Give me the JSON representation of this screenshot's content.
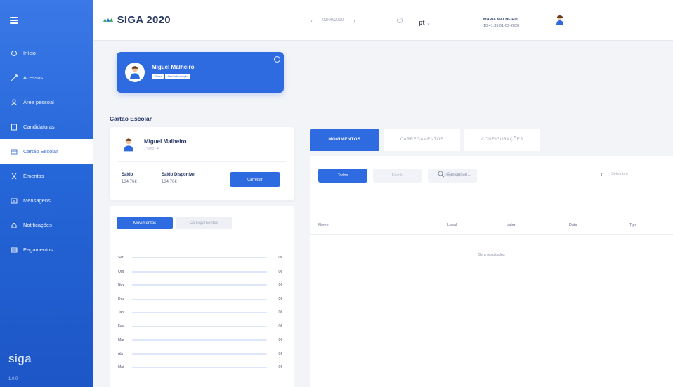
{
  "app": {
    "title": "SIGA 2020",
    "logo_text": "siga",
    "version": "1.0.0"
  },
  "colors": {
    "primary": "#2f6be0",
    "sidebar": "#2566d8",
    "background": "#f3f4f8"
  },
  "sidebar": {
    "items": [
      {
        "label": "Início",
        "icon": "home-icon",
        "active": false
      },
      {
        "label": "Acessos",
        "icon": "key-icon",
        "active": false
      },
      {
        "label": "Área pessoal",
        "icon": "user-icon",
        "active": false
      },
      {
        "label": "Candidaturas",
        "icon": "document-icon",
        "active": false
      },
      {
        "label": "Cartão Escolar",
        "icon": "card-icon",
        "active": true
      },
      {
        "label": "Ementas",
        "icon": "cutlery-icon",
        "active": false
      },
      {
        "label": "Mensagens",
        "icon": "message-icon",
        "active": false
      },
      {
        "label": "Notificações",
        "icon": "bell-icon",
        "active": false
      },
      {
        "label": "Pagamentos",
        "icon": "payment-icon",
        "active": false
      }
    ]
  },
  "header": {
    "date": "01/09/2020",
    "language": "pt",
    "user_name": "MARIA MALHEIRO",
    "user_datetime": "10:41:35 01-09-2020"
  },
  "profile": {
    "name": "Miguel Malheiro",
    "tags": [
      "1º ano",
      "Sem informação"
    ]
  },
  "section_title": "Cartão Escolar",
  "balance_card": {
    "name": "Miguel Malheiro",
    "subtitle": "1º ano · A",
    "saldo_label": "Saldo",
    "saldo_value": "134,76€",
    "disponivel_label": "Saldo Disponível",
    "disponivel_value": "134,76€",
    "load_button": "Carregar"
  },
  "chart_card": {
    "tabs": [
      {
        "label": "Movimentos",
        "active": true
      },
      {
        "label": "Carregamentos",
        "active": false
      }
    ]
  },
  "chart_data": {
    "type": "bar",
    "categories": [
      "Set",
      "Out",
      "Nov",
      "Dez",
      "Jan",
      "Fev",
      "Mar",
      "Abr",
      "Mai"
    ],
    "values": [
      0,
      0,
      0,
      0,
      0,
      0,
      0,
      0,
      0
    ],
    "value_labels": [
      "0€",
      "0€",
      "0€",
      "0€",
      "0€",
      "0€",
      "0€",
      "0€",
      "0€"
    ],
    "title": "",
    "xlabel": "",
    "ylabel": "",
    "legend": "none"
  },
  "main": {
    "tabs": [
      {
        "label": "MOVIMENTOS",
        "active": true
      },
      {
        "label": "CARREGAMENTOS",
        "active": false
      },
      {
        "label": "CONFIGURAÇÕES",
        "active": false
      }
    ],
    "filters": [
      {
        "label": "Todos",
        "active": true
      },
      {
        "label": "Escola",
        "active": false
      },
      {
        "label": "Papelaria",
        "active": false
      }
    ],
    "search_placeholder": "Pesquisar...",
    "pager_label": "Setembro",
    "columns": [
      "Nome",
      "Local",
      "Valor",
      "Data",
      "Tipo"
    ],
    "empty_message": "Sem resultados"
  }
}
